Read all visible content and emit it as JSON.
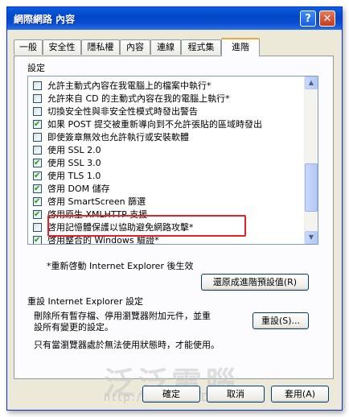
{
  "window": {
    "title": "網際網路 內容",
    "help_glyph": "?",
    "close_glyph": "✕"
  },
  "tabs": [
    {
      "label": "一般"
    },
    {
      "label": "安全性"
    },
    {
      "label": "隱私權"
    },
    {
      "label": "內容"
    },
    {
      "label": "連線"
    },
    {
      "label": "程式集"
    },
    {
      "label": "進階"
    }
  ],
  "settings": {
    "label": "設定",
    "items": [
      {
        "label": "允許主動式內容在我電腦上的檔案中執行*",
        "checked": false
      },
      {
        "label": "允許來自 CD 的主動式內容在我的電腦上執行*",
        "checked": false
      },
      {
        "label": "切換安全性與非安全性模式時發出警告",
        "checked": false
      },
      {
        "label": "如果 POST 提交被重新導向到不允許張貼的區域時發出",
        "checked": true
      },
      {
        "label": "即使簽章無效也允許執行或安裝軟體",
        "checked": false
      },
      {
        "label": "使用 SSL 2.0",
        "checked": false
      },
      {
        "label": "使用 SSL 3.0",
        "checked": true
      },
      {
        "label": "使用 TLS 1.0",
        "checked": true
      },
      {
        "label": "啓用 DOM 儲存",
        "checked": true
      },
      {
        "label": "啓用 SmartScreen 篩選",
        "checked": true
      },
      {
        "label": "啓用原生 XMLHTTP 支援",
        "checked": true
      },
      {
        "label": "啓用記憶體保護以協助避免網路攻擊*",
        "checked": false
      },
      {
        "label": "啓用整合的 Windows 驗證*",
        "checked": true
      }
    ],
    "restart_note": "*重新啓動 Internet Explorer 後生效",
    "restore_button": "還原成進階預設值(R)"
  },
  "reset": {
    "title": "重設 Internet Explorer 設定",
    "desc_line1": "刪除所有暫存檔、停用瀏覽器附加元件，並重",
    "desc_line2": "設所有變更的設定。",
    "button": "重設(S)...",
    "note": "只有當瀏覽器處於無法使用狀態時，才能使用。"
  },
  "footer": {
    "ok": "確定",
    "cancel": "取消",
    "apply": "套用(A)"
  },
  "watermark": {
    "line1": "泛泛電腦",
    "line2": "http://www.FWDS.com"
  }
}
